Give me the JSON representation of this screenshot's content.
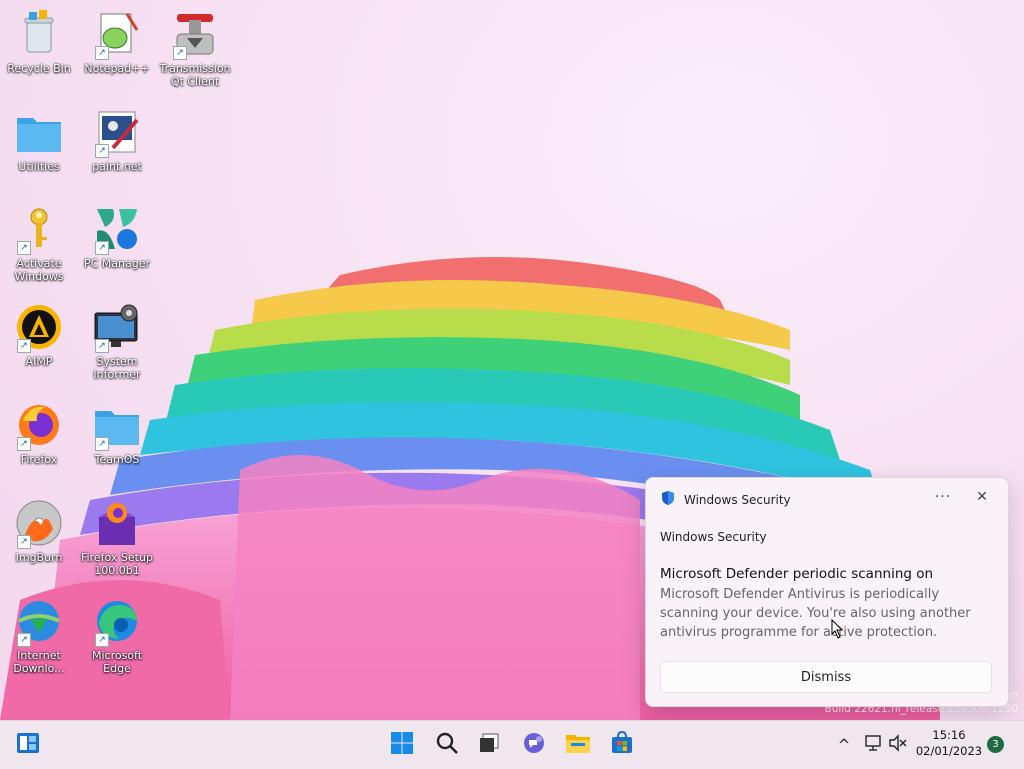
{
  "desktop": {
    "icons": [
      {
        "label": "Recycle Bin",
        "icon": "recycle-bin-icon"
      },
      {
        "label": "Notepad++",
        "icon": "notepadpp-icon"
      },
      {
        "label": "Transmission Qt Client",
        "icon": "transmission-icon"
      },
      {
        "label": "Utilities",
        "icon": "folder-icon"
      },
      {
        "label": "paint.net",
        "icon": "paintnet-icon"
      },
      {
        "label": "Activate Windows",
        "icon": "key-icon"
      },
      {
        "label": "PC Manager",
        "icon": "pc-manager-icon"
      },
      {
        "label": "AIMP",
        "icon": "aimp-icon"
      },
      {
        "label": "System Informer",
        "icon": "system-informer-icon"
      },
      {
        "label": "Firefox",
        "icon": "firefox-icon"
      },
      {
        "label": "TeamOS",
        "icon": "folder-icon"
      },
      {
        "label": "ImgBurn",
        "icon": "imgburn-icon"
      },
      {
        "label": "Firefox Setup 100.0b1",
        "icon": "firefox-setup-icon"
      },
      {
        "label": "Internet Downlo...",
        "icon": "idm-icon"
      },
      {
        "label": "Microsoft Edge",
        "icon": "edge-icon"
      }
    ],
    "watermark": {
      "line1": "on",
      "line2": "Build 22621.ni_release.220506-1250"
    }
  },
  "toast": {
    "header": "Windows Security",
    "more_label": "···",
    "close_label": "✕",
    "app_name": "Windows Security",
    "title": "Microsoft Defender periodic scanning on",
    "body": "Microsoft Defender Antivirus is periodically scanning your device. You're also using another antivirus programme for active protection.",
    "dismiss_label": "Dismiss"
  },
  "taskbar": {
    "items": [
      "widgets-icon",
      "start-icon",
      "search-icon",
      "task-view-icon",
      "teams-chat-icon",
      "file-explorer-icon",
      "store-icon"
    ],
    "tray": {
      "chevron": "^"
    },
    "clock": {
      "time": "15:16",
      "date": "02/01/2023"
    },
    "notifications": "3"
  },
  "colors": {
    "accent": "#0a64c8",
    "taskbar": "#efe6ee",
    "badge": "#1e6b44"
  }
}
